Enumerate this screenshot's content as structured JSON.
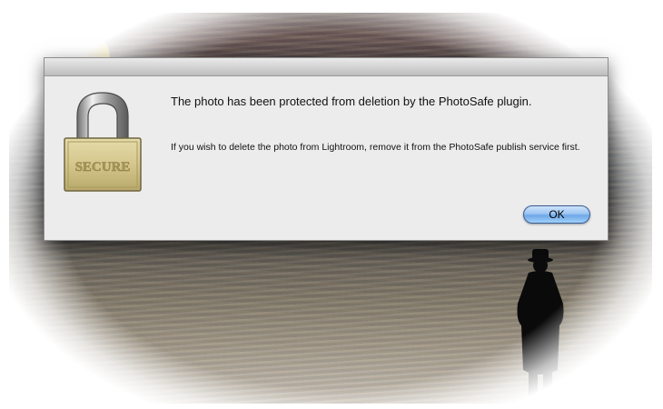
{
  "dialog": {
    "title": "The photo has been protected from deletion by the PhotoSafe plugin.",
    "message": "If you wish to delete the photo from Lightroom, remove it from the PhotoSafe publish service first.",
    "icon": "padlock-icon",
    "icon_label": "SECURE",
    "ok_label": "OK"
  },
  "background": {
    "description_icons": [
      "sun-icon",
      "person-silhouette-icon"
    ]
  },
  "colors": {
    "dialog_bg": "#ececec",
    "button_accent": "#6fa7e6",
    "sun": "#f8cf20"
  }
}
